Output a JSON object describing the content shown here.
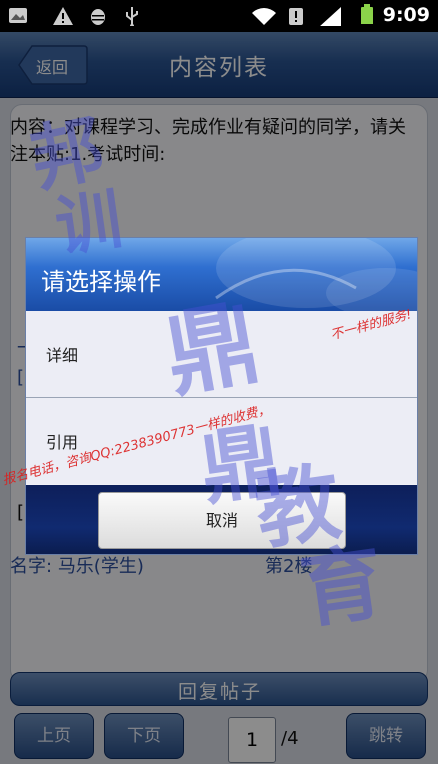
{
  "status_bar": {
    "time": "9:09",
    "icons": [
      "photo-notification-icon",
      "warning-icon",
      "android-debug-icon",
      "usb-icon",
      "wifi-icon",
      "data-icon",
      "signal-icon",
      "battery-icon"
    ]
  },
  "header": {
    "back_label": "返回",
    "title": "内容列表"
  },
  "post": {
    "text": "内容：对课程学习、完成作业有疑问的同学，请关注本贴:1.考试时间:",
    "author_label": "名字:",
    "author": "马乐(学生)",
    "floor": "第2楼"
  },
  "reply_label": "回复帖子",
  "pagination": {
    "prev_label": "上页",
    "next_label": "下页",
    "current_page": "1",
    "total": "/4",
    "jump_label": "跳转"
  },
  "dialog": {
    "title": "请选择操作",
    "options": [
      "详细",
      "引用"
    ],
    "cancel_label": "取消"
  },
  "watermark": {
    "red_left": "报名电话，咨询QQ:2238390773一样的收费，",
    "red_right": "不一样的服务!"
  },
  "colors": {
    "title_bar": "#2b5593",
    "dialog_header": "#2f6fd0",
    "link_text": "#2c4f9e"
  }
}
